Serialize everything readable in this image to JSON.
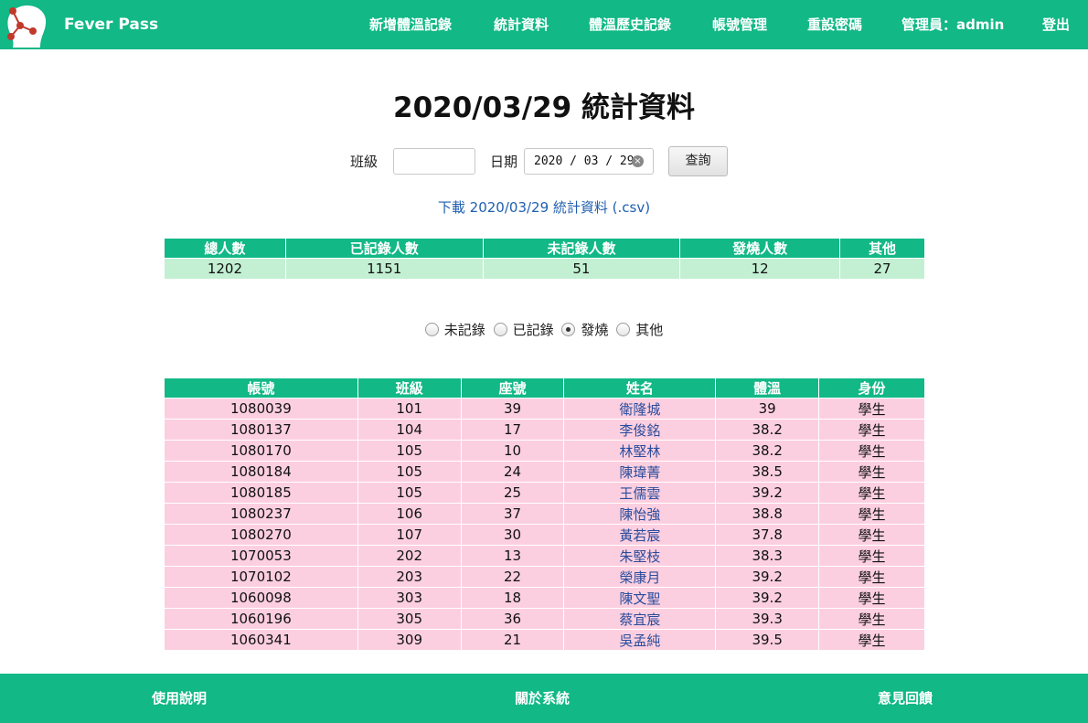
{
  "colors": {
    "brand_green": "#12b886",
    "summary_row": "#c3f0d3",
    "detail_row": "#fccfe0",
    "link_blue": "#1f5fb0"
  },
  "navbar": {
    "brand": "Fever Pass",
    "items": [
      "新增體溫記錄",
      "統計資料",
      "體溫歷史記錄",
      "帳號管理",
      "重設密碼",
      "管理員：admin",
      "登出"
    ]
  },
  "page_title": "2020/03/29 統計資料",
  "query_form": {
    "class_label": "班級",
    "class_value": "",
    "date_label": "日期",
    "date_value": "2020 / 03 / 29",
    "submit_label": "查詢"
  },
  "download_link": "下載 2020/03/29 統計資料 (.csv)",
  "summary": {
    "headers": [
      "總人數",
      "已記錄人數",
      "未記錄人數",
      "發燒人數",
      "其他"
    ],
    "values": [
      "1202",
      "1151",
      "51",
      "12",
      "27"
    ]
  },
  "filter": {
    "options": [
      "未記錄",
      "已記錄",
      "發燒",
      "其他"
    ],
    "selected": "發燒"
  },
  "detail_table": {
    "headers": [
      "帳號",
      "班級",
      "座號",
      "姓名",
      "體溫",
      "身份"
    ],
    "rows": [
      [
        "1080039",
        "101",
        "39",
        "衛隆城",
        "39",
        "學生"
      ],
      [
        "1080137",
        "104",
        "17",
        "李俊銘",
        "38.2",
        "學生"
      ],
      [
        "1080170",
        "105",
        "10",
        "林堅林",
        "38.2",
        "學生"
      ],
      [
        "1080184",
        "105",
        "24",
        "陳瑋菁",
        "38.5",
        "學生"
      ],
      [
        "1080185",
        "105",
        "25",
        "王儒雲",
        "39.2",
        "學生"
      ],
      [
        "1080237",
        "106",
        "37",
        "陳怡強",
        "38.8",
        "學生"
      ],
      [
        "1080270",
        "107",
        "30",
        "黃若宸",
        "37.8",
        "學生"
      ],
      [
        "1070053",
        "202",
        "13",
        "朱堅枝",
        "38.3",
        "學生"
      ],
      [
        "1070102",
        "203",
        "22",
        "榮康月",
        "39.2",
        "學生"
      ],
      [
        "1060098",
        "303",
        "18",
        "陳文聖",
        "39.2",
        "學生"
      ],
      [
        "1060196",
        "305",
        "36",
        "蔡宜宸",
        "39.3",
        "學生"
      ],
      [
        "1060341",
        "309",
        "21",
        "吳孟純",
        "39.5",
        "學生"
      ]
    ]
  },
  "footer": {
    "items": [
      "使用說明",
      "關於系統",
      "意見回饋"
    ]
  }
}
